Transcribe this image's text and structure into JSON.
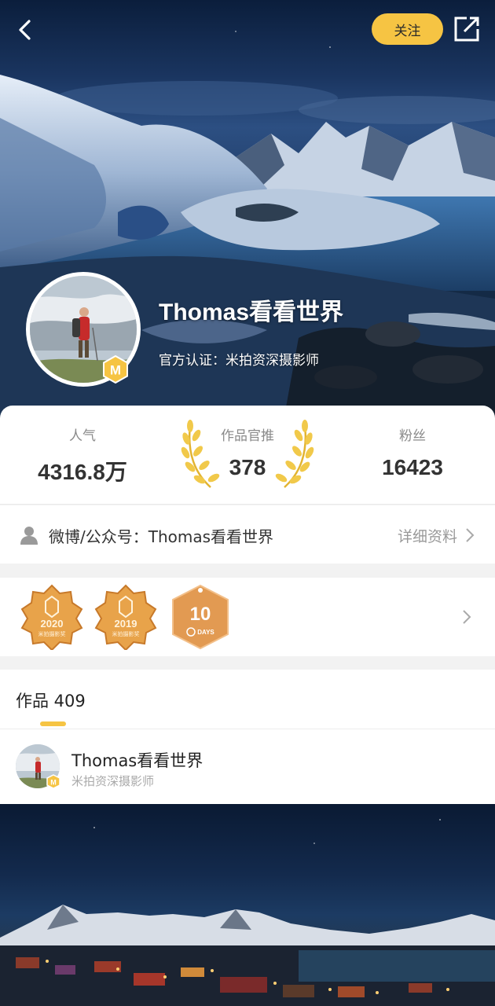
{
  "header": {
    "back_icon": "chevron-left-icon",
    "follow_label": "关注",
    "share_icon": "share-external-icon"
  },
  "profile": {
    "name": "Thomas看看世界",
    "certification": "官方认证：米拍资深摄影师",
    "badge_letter": "M"
  },
  "stats": {
    "popularity_label": "人气",
    "popularity_value": "4316.8万",
    "recommended_label": "作品官推",
    "recommended_value": "378",
    "fans_label": "粉丝",
    "fans_value": "16423"
  },
  "weibo": {
    "text": "微博/公众号：Thomas看看世界",
    "details_label": "详细资料"
  },
  "badges": [
    {
      "name": "2020 米拍摄影奖",
      "year": "2020",
      "caption": "米拍摄影奖"
    },
    {
      "name": "2019 米拍摄影奖",
      "year": "2019",
      "caption": "米拍摄影奖"
    },
    {
      "name": "10 DAYS",
      "number": "10",
      "caption": "DAYS"
    }
  ],
  "works": {
    "tab_label": "作品 409"
  },
  "author": {
    "name": "Thomas看看世界",
    "title": "米拍资深摄影师"
  },
  "colors": {
    "accent": "#f6c443",
    "badge_gold": "#e8a34a",
    "badge_bronze": "#e29a52"
  }
}
